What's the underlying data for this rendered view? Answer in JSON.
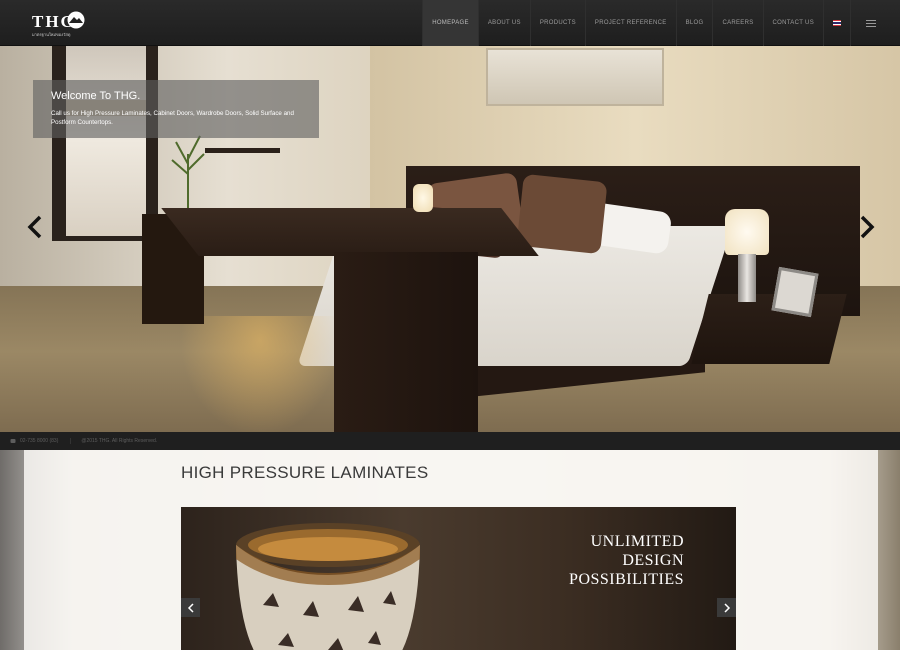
{
  "brand": {
    "logo_text": "THG",
    "tagline": "มาตรฐานใหม่ของวัสดุ"
  },
  "nav": {
    "items": [
      {
        "label": "HOMEPAGE",
        "active": true
      },
      {
        "label": "ABOUT US"
      },
      {
        "label": "PRODUCTS"
      },
      {
        "label": "PROJECT REFERENCE"
      },
      {
        "label": "BLOG"
      },
      {
        "label": "CAREERS"
      },
      {
        "label": "CONTACT US"
      }
    ],
    "language_icon": "thai-flag-icon",
    "menu_icon": "hamburger-icon"
  },
  "hero": {
    "title": "Welcome To THG.",
    "text": "Call us for High Pressure Laminates, Cabinet Doors, Wardrobe Doors, Solid Surface and Postform Countertops.",
    "prev_icon": "chevron-left-icon",
    "next_icon": "chevron-right-icon"
  },
  "info_bar": {
    "phone": "02-735 8000 (83)",
    "copyright": "@2015 THG. All Rights Reserved."
  },
  "section": {
    "title": "HIGH PRESSURE LAMINATES",
    "banner_lines": [
      "UNLIMITED",
      "DESIGN",
      "POSSIBILITIES"
    ]
  },
  "colors": {
    "header_bg": "#222222",
    "nav_active_bg": "#353535",
    "caption_bg": "#5f5f5f"
  }
}
